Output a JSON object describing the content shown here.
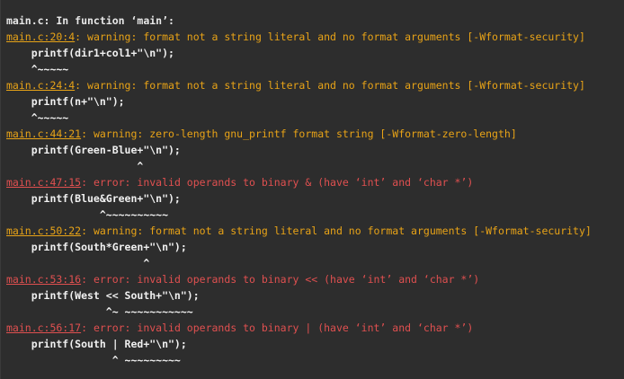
{
  "header": "main.c: In function ‘main’:",
  "diagnostics": [
    {
      "kind": "warning",
      "location": "main.c:20:4",
      "message": ": warning: format not a string literal and no format arguments [-Wformat-security]",
      "code": "    printf(dir1+col1+\"\\n\");",
      "caret": "    ^~~~~~"
    },
    {
      "kind": "warning",
      "location": "main.c:24:4",
      "message": ": warning: format not a string literal and no format arguments [-Wformat-security]",
      "code": "    printf(n+\"\\n\");",
      "caret": "    ^~~~~~"
    },
    {
      "kind": "warning",
      "location": "main.c:44:21",
      "message": ": warning: zero-length gnu_printf format string [-Wformat-zero-length]",
      "code": "    printf(Green-Blue+\"\\n\");",
      "caret": "                     ^"
    },
    {
      "kind": "error",
      "location": "main.c:47:15",
      "message": ": error: invalid operands to binary & (have ‘int’ and ‘char *’)",
      "code": "    printf(Blue&Green+\"\\n\");",
      "caret": "               ^~~~~~~~~~~"
    },
    {
      "kind": "warning",
      "location": "main.c:50:22",
      "message": ": warning: format not a string literal and no format arguments [-Wformat-security]",
      "code": "    printf(South*Green+\"\\n\");",
      "caret": "                      ^"
    },
    {
      "kind": "error",
      "location": "main.c:53:16",
      "message": ": error: invalid operands to binary << (have ‘int’ and ‘char *’)",
      "code": "    printf(West << South+\"\\n\");",
      "caret": "                ^~ ~~~~~~~~~~~"
    },
    {
      "kind": "error",
      "location": "main.c:56:17",
      "message": ": error: invalid operands to binary | (have ‘int’ and ‘char *’)",
      "code": "    printf(South | Red+\"\\n\");",
      "caret": "                 ^ ~~~~~~~~~"
    }
  ]
}
